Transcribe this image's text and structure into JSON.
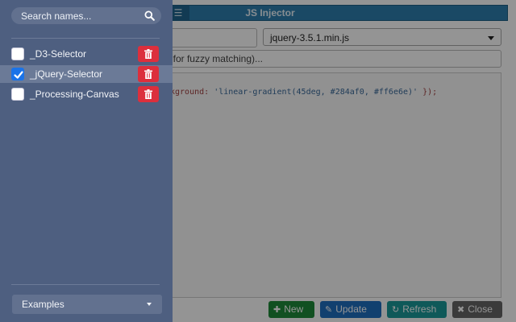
{
  "app": {
    "title": "JS Injector",
    "library_select": {
      "value": "jquery-3.5.1.min.js"
    },
    "match_input": {
      "value": "' for fuzzy matching)..."
    },
    "editor": {
      "code_prefix": "kground: ",
      "code_string": "'linear-gradient(45deg, #284af0, #ff6e6e)'",
      "code_suffix": " });"
    },
    "buttons": {
      "new": "New",
      "update": "Update",
      "refresh": "Refresh",
      "close": "Close"
    }
  },
  "sidebar": {
    "search": {
      "placeholder": "Search names...",
      "value": ""
    },
    "items": [
      {
        "label": "_D3-Selector",
        "checked": false,
        "selected": false
      },
      {
        "label": "_jQuery-Selector",
        "checked": true,
        "selected": true
      },
      {
        "label": "_Processing-Canvas",
        "checked": false,
        "selected": false
      }
    ],
    "examples": {
      "label": "Examples"
    }
  },
  "colors": {
    "sidebar_bg": "#4e5f80",
    "selected_row": "#6b7a97",
    "delete_button": "#dc2f3c",
    "checkbox_checked": "#1a73e8",
    "titlebar": "#2e7fae"
  }
}
